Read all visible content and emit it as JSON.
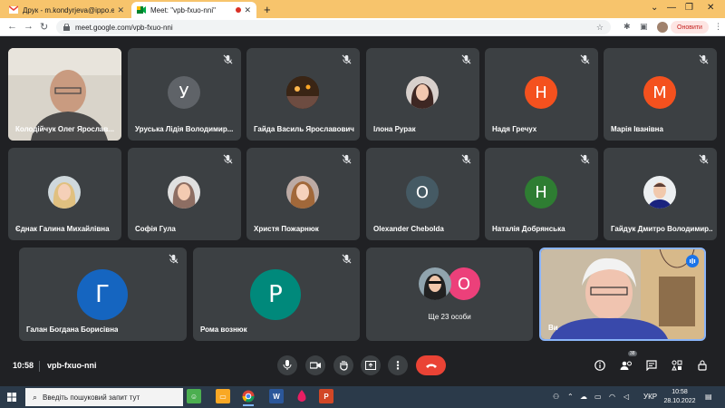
{
  "browser": {
    "tabs": [
      {
        "title": "Друк - m.kondyrjeva@ippo.edu...",
        "favicon": "gmail-icon",
        "active": false
      },
      {
        "title": "Meet: \"vpb-fxuo-nni\"",
        "favicon": "meet-icon",
        "active": true
      }
    ],
    "url": "meet.google.com/vpb-fxuo-nni",
    "update_label": "Оновити"
  },
  "participants": {
    "row1": [
      {
        "name": "Колодійчук Олег Ярослав...",
        "type": "video"
      },
      {
        "name": "Уруська Лідія Володимир...",
        "initial": "У",
        "color": "#5f6368"
      },
      {
        "name": "Гайда Василь Ярославович",
        "type": "photo"
      },
      {
        "name": "Ілона Рурак",
        "type": "photo"
      },
      {
        "name": "Надя Гречух",
        "initial": "Н",
        "color": "#f4511e"
      },
      {
        "name": "Марія Іванівна",
        "initial": "М",
        "color": "#f4511e"
      }
    ],
    "row2": [
      {
        "name": "Єднак Галина Михайлівна",
        "type": "photo"
      },
      {
        "name": "Софія Гула",
        "type": "photo"
      },
      {
        "name": "Христя Пожарнюк",
        "type": "photo"
      },
      {
        "name": "Olexander Chebolda",
        "initial": "O",
        "color": "#455a64"
      },
      {
        "name": "Наталія Добрянська",
        "initial": "Н",
        "color": "#2e7d32"
      },
      {
        "name": "Гайдук Дмитро Володимир...",
        "type": "photo"
      }
    ],
    "row3": [
      {
        "name": "Галан Богдана Борисівна",
        "initial": "Г",
        "color": "#1565c0"
      },
      {
        "name": "Рома вознюк",
        "initial": "Р",
        "color": "#00897b"
      },
      {
        "name": "Ще 23 особи",
        "initial": "O",
        "color": "#ec407a"
      },
      {
        "name": "Ви",
        "type": "video"
      }
    ]
  },
  "meeting": {
    "time": "10:58",
    "code": "vpb-fxuo-nni",
    "people_count": "38"
  },
  "taskbar": {
    "search_placeholder": "Введіть пошуковий запит тут",
    "language": "УКР",
    "time": "10:58",
    "date": "28.10.2022"
  }
}
